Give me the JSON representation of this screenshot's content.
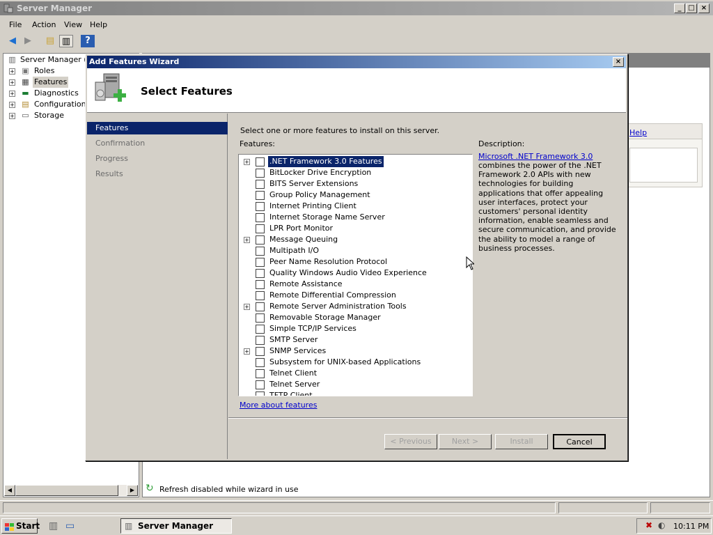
{
  "main_window": {
    "title": "Server Manager",
    "menu": [
      "File",
      "Action",
      "View",
      "Help"
    ],
    "toolbar_icons": [
      "back-arrow-icon",
      "forward-arrow-icon",
      "up-folder-icon",
      "show-hide-console-tree-icon",
      "help-icon"
    ]
  },
  "tree": {
    "root": "Server Manager (W",
    "items": [
      {
        "label": "Roles",
        "icon": "roles-icon"
      },
      {
        "label": "Features",
        "icon": "features-icon"
      },
      {
        "label": "Diagnostics",
        "icon": "diagnostics-icon"
      },
      {
        "label": "Configuration",
        "icon": "configuration-icon"
      },
      {
        "label": "Storage",
        "icon": "storage-icon"
      }
    ]
  },
  "right_pane": {
    "help_link": "Help"
  },
  "status": {
    "refresh_text": "Refresh disabled while wizard in use"
  },
  "dialog": {
    "title": "Add Features Wizard",
    "header_title": "Select Features",
    "nav": [
      "Features",
      "Confirmation",
      "Progress",
      "Results"
    ],
    "instruction": "Select one or more features to install on this server.",
    "features_label": "Features:",
    "features": [
      {
        "label": ".NET Framework 3.0 Features",
        "expandable": true,
        "selected": true
      },
      {
        "label": "BitLocker Drive Encryption",
        "expandable": false
      },
      {
        "label": "BITS Server Extensions",
        "expandable": false
      },
      {
        "label": "Group Policy Management",
        "expandable": false
      },
      {
        "label": "Internet Printing Client",
        "expandable": false
      },
      {
        "label": "Internet Storage Name Server",
        "expandable": false
      },
      {
        "label": "LPR Port Monitor",
        "expandable": false
      },
      {
        "label": "Message Queuing",
        "expandable": true
      },
      {
        "label": "Multipath I/O",
        "expandable": false
      },
      {
        "label": "Peer Name Resolution Protocol",
        "expandable": false
      },
      {
        "label": "Quality Windows Audio Video Experience",
        "expandable": false
      },
      {
        "label": "Remote Assistance",
        "expandable": false
      },
      {
        "label": "Remote Differential Compression",
        "expandable": false
      },
      {
        "label": "Remote Server Administration Tools",
        "expandable": true
      },
      {
        "label": "Removable Storage Manager",
        "expandable": false
      },
      {
        "label": "Simple TCP/IP Services",
        "expandable": false
      },
      {
        "label": "SMTP Server",
        "expandable": false
      },
      {
        "label": "SNMP Services",
        "expandable": true
      },
      {
        "label": "Subsystem for UNIX-based Applications",
        "expandable": false
      },
      {
        "label": "Telnet Client",
        "expandable": false
      },
      {
        "label": "Telnet Server",
        "expandable": false
      },
      {
        "label": "TFTP Client",
        "expandable": false
      }
    ],
    "description_label": "Description:",
    "description_link": "Microsoft .NET Framework 3.0",
    "description_text": "combines the power of the .NET Framework 2.0 APIs with new technologies for building applications that offer appealing user interfaces, protect your customers' personal identity information, enable seamless and secure communication, and provide the ability to model a range of business processes.",
    "more_link": "More about features",
    "buttons": {
      "previous": "< Previous",
      "next": "Next >",
      "install": "Install",
      "cancel": "Cancel"
    }
  },
  "taskbar": {
    "start": "Start",
    "task": "Server Manager",
    "clock": "10:11 PM"
  },
  "colors": {
    "title_active": "#0a246a",
    "title_inactive": "#808080",
    "face": "#d4d0c8",
    "link": "#0000cc"
  }
}
